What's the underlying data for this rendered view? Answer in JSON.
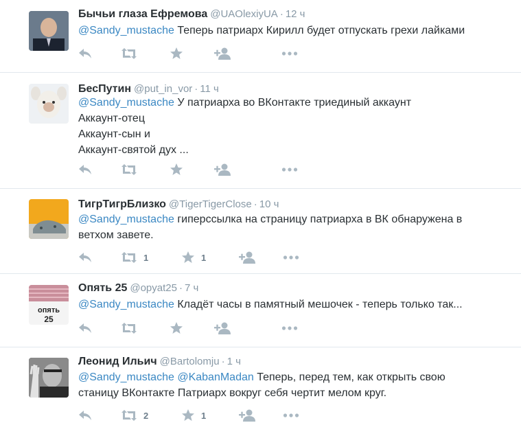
{
  "tweets": [
    {
      "name": "Бычьи глаза Ефремова",
      "handle": "@UAOlexiyUA",
      "time": "12 ч",
      "mentions": [
        "@Sandy_mustache"
      ],
      "lines": [
        "Теперь патриарх Кирилл будет отпускать грехи лайками"
      ],
      "retweets": "",
      "favorites": ""
    },
    {
      "name": "БесПутин",
      "handle": "@put_in_vor",
      "time": "11 ч",
      "mentions": [
        "@Sandy_mustache"
      ],
      "lines": [
        "У патриарха во ВКонтакте триединый аккаунт",
        "Аккаунт-отец",
        "Аккаунт-сын и",
        "Аккаунт-святой дух ..."
      ],
      "retweets": "",
      "favorites": ""
    },
    {
      "name": "ТигрТигрБлизко",
      "handle": "@TigerTigerClose",
      "time": "10 ч",
      "mentions": [
        "@Sandy_mustache"
      ],
      "lines": [
        "гиперссылка на страницу патриарха в ВК обнаружена в",
        "ветхом завете."
      ],
      "retweets": "1",
      "favorites": "1"
    },
    {
      "name": "Опять 25",
      "handle": "@opyat25",
      "time": "7 ч",
      "mentions": [
        "@Sandy_mustache"
      ],
      "lines": [
        "Кладёт часы в памятный мешочек - теперь только так..."
      ],
      "retweets": "",
      "favorites": "",
      "avatar_text": [
        "опять",
        "25"
      ]
    },
    {
      "name": "Леонид Ильич",
      "handle": "@Bartolomju",
      "time": "1 ч",
      "mentions": [
        "@Sandy_mustache",
        "@KabanMadan"
      ],
      "lines": [
        "Теперь, перед тем, как открыть свою",
        "станицу ВКонтакте Патриарх вокруг себя чертит мелом круг."
      ],
      "retweets": "2",
      "favorites": "1"
    }
  ],
  "separator": "·",
  "colors": {
    "mention": "#3b88c3",
    "muted": "#8899a6",
    "icon": "#aab8c2",
    "border": "#e1e8ed"
  }
}
